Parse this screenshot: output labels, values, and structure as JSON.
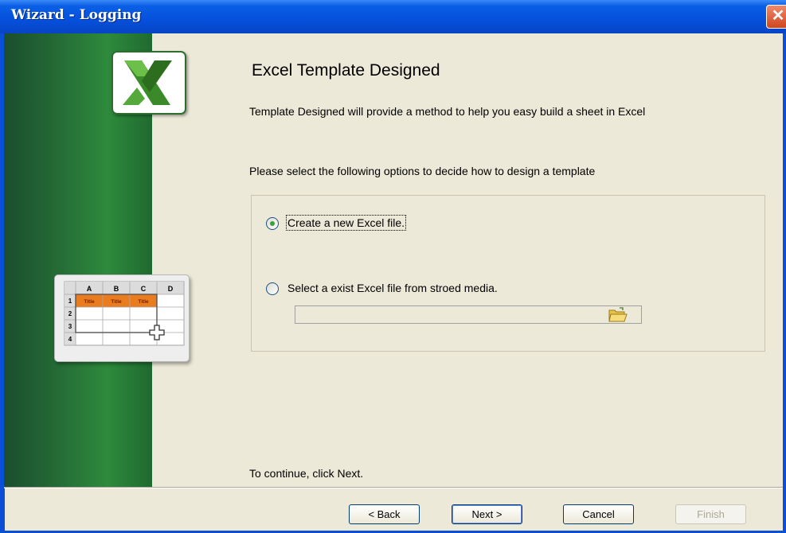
{
  "window": {
    "title": "Wizard - Logging",
    "close_glyph": "✕"
  },
  "side_panel": {
    "logo_icon": "excel-logo-icon",
    "grid": {
      "columns": [
        "A",
        "B",
        "C",
        "D"
      ],
      "rows": [
        "1",
        "2",
        "3",
        "4"
      ],
      "header_cells": [
        "Title",
        "Title",
        "Title"
      ]
    }
  },
  "content": {
    "title": "Excel Template Designed",
    "description": "Template Designed will provide a method to help you easy build a  sheet in Excel",
    "instruction": "Please select the following options to decide how to design a template",
    "options": [
      {
        "label": "Create a new Excel file.",
        "selected": true
      },
      {
        "label": "Select a exist  Excel file from stroed media.",
        "selected": false
      }
    ],
    "path_field": {
      "value": ""
    },
    "browse_icon": "folder-open-icon",
    "continue_text": "To continue, click Next."
  },
  "buttons": {
    "back": "< Back",
    "next": "Next >",
    "cancel": "Cancel",
    "finish": "Finish"
  },
  "colors": {
    "titlebar": "#0550dc",
    "panel_green": "#2e8a3c",
    "grid_header_orange": "#e87c1e",
    "radio_dot": "#3aa03a"
  }
}
